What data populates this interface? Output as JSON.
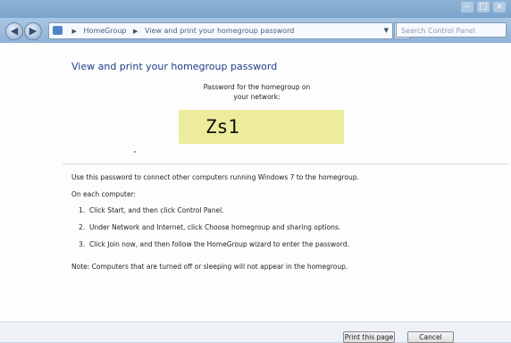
{
  "window": {
    "minimize_icon": "minimize-icon",
    "maximize_icon": "maximize-icon",
    "close_icon": "close-icon"
  },
  "nav": {
    "breadcrumb": [
      "HomeGroup",
      "View and print your homegroup password"
    ],
    "search_placeholder": "Search Control Panel"
  },
  "page": {
    "heading": "View and print your homegroup password",
    "password_label_line1": "Password for the homegroup on",
    "password_label_line2": "your network:",
    "password": "Zs1",
    "password_box_color": "#ecec9c",
    "intro": "Use this password to connect other computers running Windows 7 to the homegroup.",
    "on_each": "On each computer:",
    "steps": [
      {
        "num": "1.",
        "text": "Click Start, and then click Control Panel."
      },
      {
        "num": "2.",
        "text": "Under Network and Internet, click Choose homegroup and sharing options."
      },
      {
        "num": "3.",
        "text": "Click Join now, and then follow the HomeGroup wizard to enter the password."
      }
    ],
    "note": "Note: Computers that are turned off or sleeping will not appear in the homegroup."
  },
  "footer": {
    "print_label": "Print this page",
    "cancel_label": "Cancel"
  }
}
